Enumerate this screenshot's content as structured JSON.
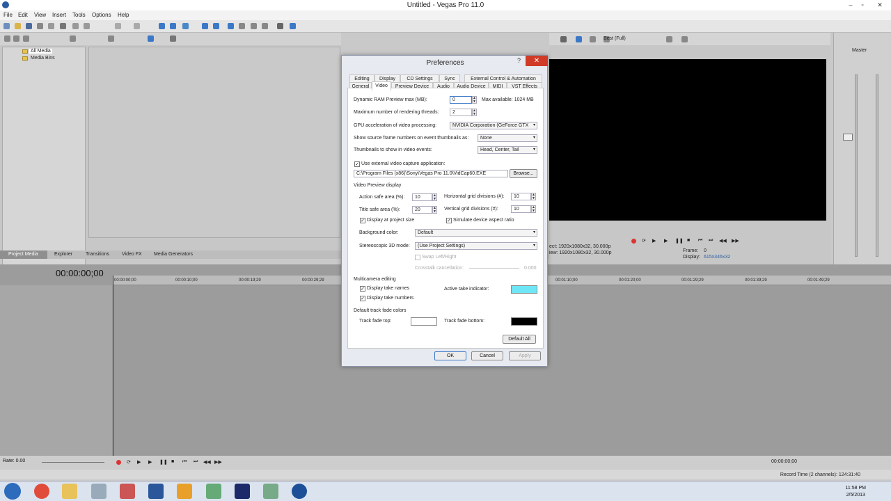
{
  "app": {
    "title": "Untitled - Vegas Pro 11.0"
  },
  "menu": [
    "File",
    "Edit",
    "View",
    "Insert",
    "Tools",
    "Options",
    "Help"
  ],
  "project_media": {
    "tree": [
      "All Media",
      "Media Bins"
    ]
  },
  "dock_tabs": [
    "Project Media",
    "Explorer",
    "Transitions",
    "Video FX",
    "Media Generators"
  ],
  "preview": {
    "quality": "Best (Full)",
    "info_project": "ect:   1920x1080x32, 30.000p",
    "info_preview": "iew:   1920x1080x32, 30.000p",
    "frame_label": "Frame:",
    "frame_value": "0",
    "display_label": "Display:",
    "display_value": "615x346x32"
  },
  "mixer": {
    "label": "Master"
  },
  "timeline": {
    "timecode": "00:00:00;00",
    "ruler": [
      "00:00:00;00",
      "00:00:10;00",
      "00:00:19;29",
      "00:00:29;29",
      "00:01:10;00",
      "00:01:20;00",
      "00:01:29;29",
      "00:01:39;29",
      "00:01:49;29"
    ],
    "rate": "Rate: 0.00",
    "end_timecode": "00:00:00;00"
  },
  "status": {
    "record_time": "Record Time (2 channels): 124:31:40"
  },
  "clock": {
    "time": "11:58 PM",
    "date": "2/5/2013"
  },
  "dialog": {
    "title": "Preferences",
    "help": "?",
    "close": "✕",
    "tabs_row1": [
      "Editing",
      "Display",
      "CD Settings",
      "Sync",
      "External Control & Automation"
    ],
    "tabs_row2": [
      "General",
      "Video",
      "Preview Device",
      "Audio",
      "Audio Device",
      "MIDI",
      "VST Effects"
    ],
    "dynamic_ram_label": "Dynamic RAM Preview max (MB):",
    "dynamic_ram_value": "0",
    "max_available": "Max available: 1024 MB",
    "threads_label": "Maximum number of rendering threads:",
    "threads_value": "2",
    "gpu_label": "GPU acceleration of video processing:",
    "gpu_value": "NVIDIA Corporation (GeForce GTX",
    "frame_numbers_label": "Show source frame numbers on event thumbnails as:",
    "frame_numbers_value": "None",
    "thumbnails_label": "Thumbnails to show in video events:",
    "thumbnails_value": "Head, Center, Tail",
    "ext_capture_label": "Use external video capture application:",
    "ext_capture_path": "C:\\Program Files (x86)\\Sony\\Vegas Pro 11.0\\VidCap60.EXE",
    "browse": "Browse...",
    "vpd_section": "Video Preview display",
    "action_safe_label": "Action safe area (%):",
    "action_safe_value": "10",
    "title_safe_label": "Title safe area (%):",
    "title_safe_value": "20",
    "hgrid_label": "Horizontal grid divisions (#):",
    "hgrid_value": "10",
    "vgrid_label": "Vertical grid divisions (#):",
    "vgrid_value": "10",
    "display_project_size": "Display at project size",
    "simulate_aspect": "Simulate device aspect ratio",
    "bg_color_label": "Background color:",
    "bg_color_value": "Default",
    "stereo_label": "Stereoscopic 3D mode:",
    "stereo_value": "(Use Project Settings)",
    "swap": "Swap Left/Right",
    "crosstalk_label": "Crosstalk cancellation:",
    "crosstalk_value": "0.000",
    "multicam_section": "Multicamera editing",
    "display_take_names": "Display take names",
    "display_take_numbers": "Display take numbers",
    "active_take_label": "Active take indicator:",
    "fade_section": "Default track fade colors",
    "fade_top_label": "Track fade top:",
    "fade_bottom_label": "Track fade bottom:",
    "default_all": "Default All",
    "ok": "OK",
    "cancel": "Cancel",
    "apply": "Apply",
    "check": "✓",
    "colors": {
      "active_take": "#6ee6f5",
      "fade_top": "#ffffff",
      "fade_bottom": "#000000"
    }
  }
}
